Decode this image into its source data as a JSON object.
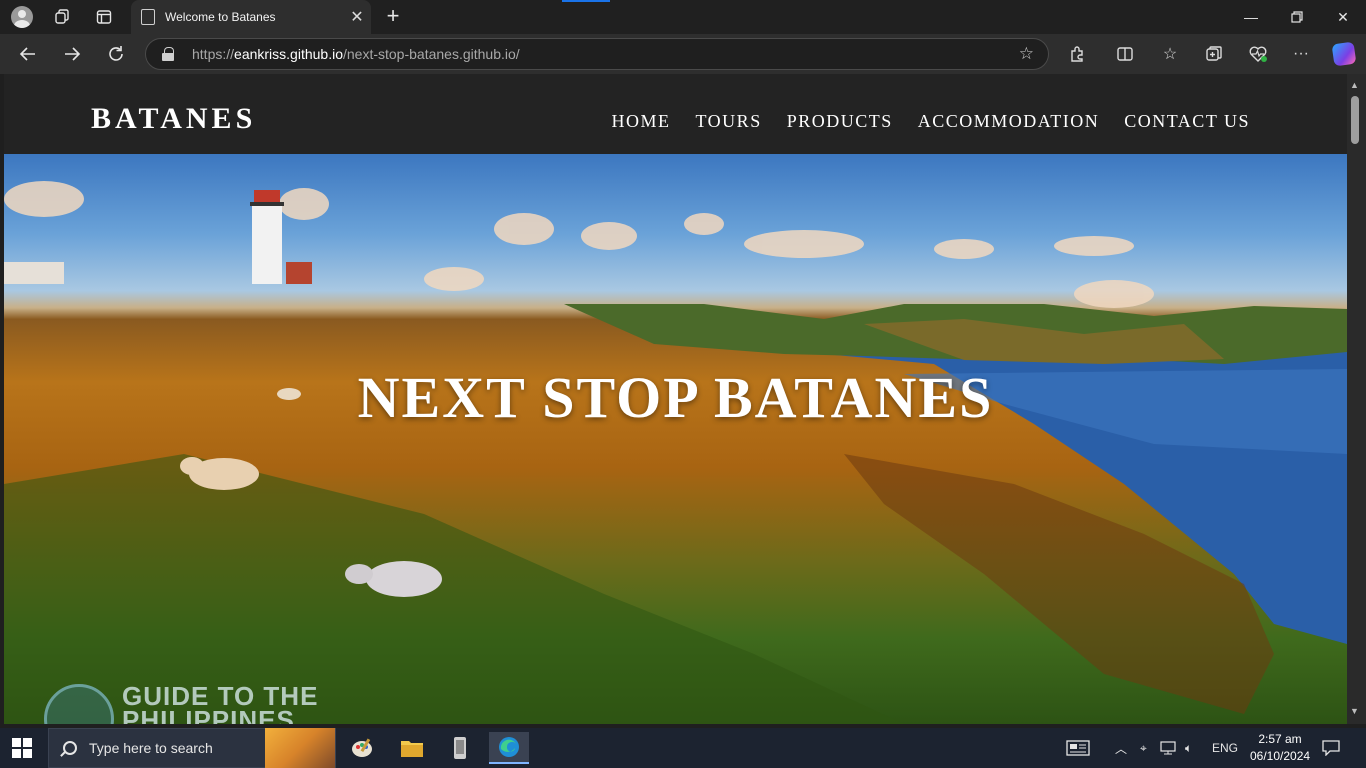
{
  "browser": {
    "tab_title": "Welcome to Batanes",
    "url_domain": "eankriss.github.io",
    "url_prefix": "https://",
    "url_path": "/next-stop-batanes.github.io/"
  },
  "site": {
    "logo": "BATANES",
    "nav": [
      "HOME",
      "TOURS",
      "PRODUCTS",
      "ACCOMMODATION",
      "CONTACT US"
    ],
    "hero_title": "NEXT STOP BATANES",
    "watermark_line1": "GUIDE TO THE",
    "watermark_line2": "PHILIPPINES"
  },
  "taskbar": {
    "search_placeholder": "Type here to search",
    "language": "ENG",
    "time": "2:57 am",
    "date": "06/10/2024"
  },
  "colors": {
    "header_bg": "#232323",
    "chrome_bg": "#202020",
    "taskbar_bg": "#1c2330"
  }
}
